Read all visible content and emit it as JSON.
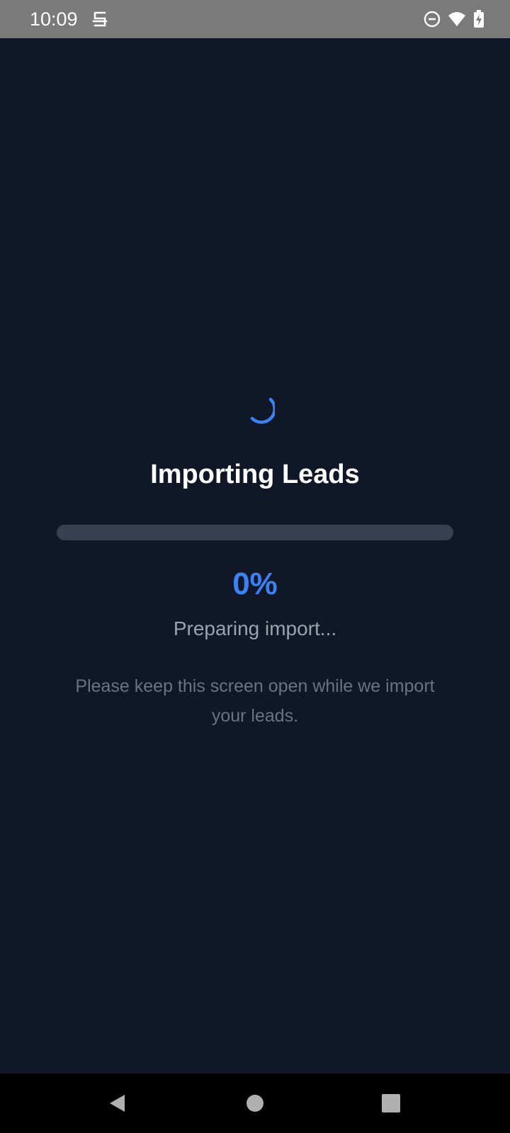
{
  "status_bar": {
    "time": "10:09",
    "app_icon": "app-notification-icon",
    "icons": [
      "do-not-disturb-icon",
      "wifi-icon",
      "battery-charging-icon"
    ]
  },
  "import_screen": {
    "spinner_icon": "loading-spinner-icon",
    "title": "Importing Leads",
    "progress_fraction": 0.0,
    "percent_label": "0%",
    "status": "Preparing import...",
    "hint": "Please keep this screen open while we import your leads."
  },
  "nav_bar": {
    "buttons": [
      "back-icon",
      "home-icon",
      "recents-icon"
    ]
  },
  "colors": {
    "background": "#101828",
    "accent": "#3b82f6",
    "track": "#374151",
    "status_bar": "#7a7a7a"
  }
}
